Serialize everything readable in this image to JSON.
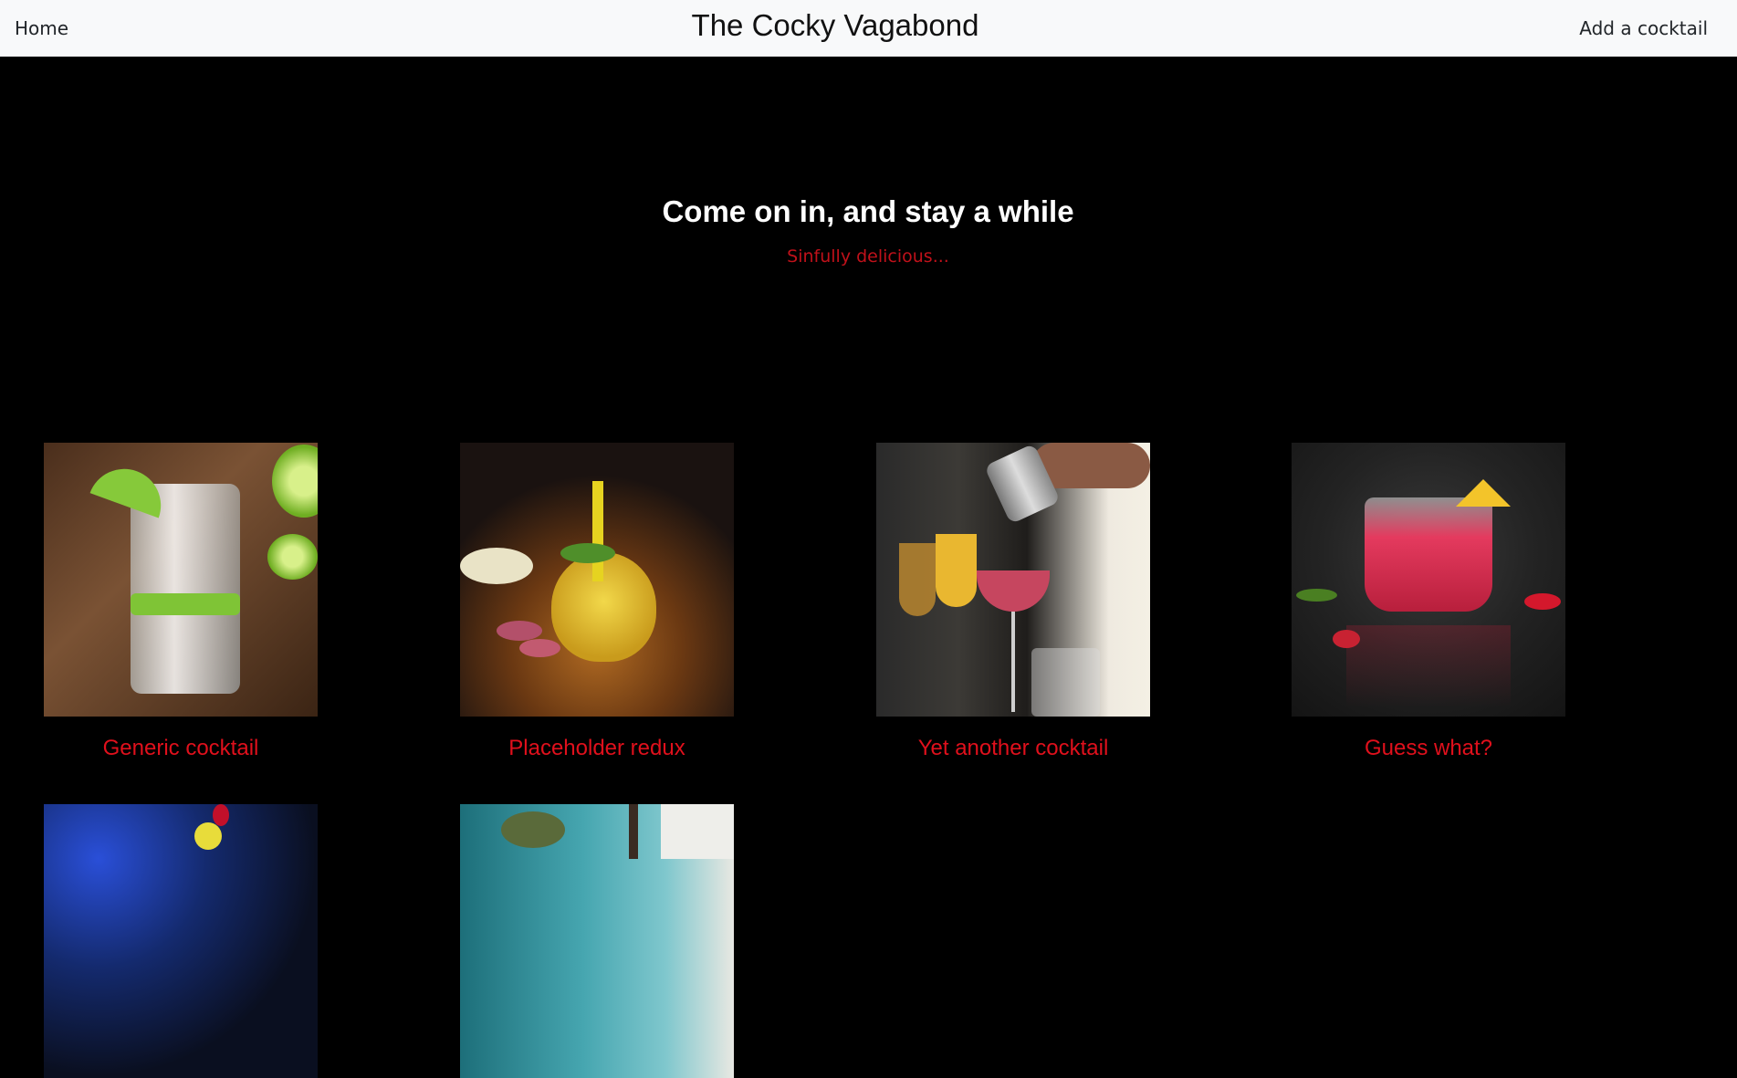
{
  "navbar": {
    "home_label": "Home",
    "brand": "The Cocky Vagabond",
    "add_label": "Add a cocktail"
  },
  "hero": {
    "title": "Come on in, and stay a while",
    "subtitle": "Sinfully delicious..."
  },
  "cocktails": [
    {
      "title": "Generic cocktail",
      "image": "gin-and-lime-photo"
    },
    {
      "title": "Placeholder redux",
      "image": "passion-fruit-cocktail-photo"
    },
    {
      "title": "Yet another cocktail",
      "image": "bartender-pouring-photo"
    },
    {
      "title": "Guess what?",
      "image": "red-cocktail-pineapple-photo"
    },
    {
      "title": "",
      "image": "blue-cocktail-cherry-photo"
    },
    {
      "title": "",
      "image": "teal-herb-cocktail-photo"
    }
  ],
  "colors": {
    "navbar_bg": "#f8f9fa",
    "page_bg": "#000000",
    "accent_red": "#e0101c",
    "hero_title": "#ffffff"
  }
}
